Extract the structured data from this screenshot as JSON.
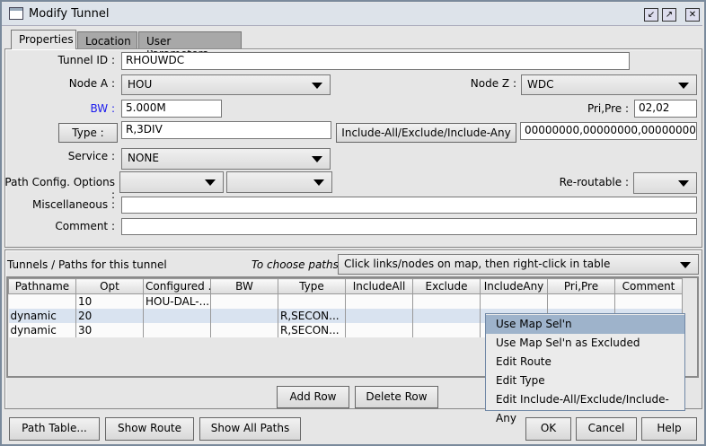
{
  "window": {
    "title": "Modify Tunnel"
  },
  "tabs": [
    {
      "label": "Properties"
    },
    {
      "label": "Location"
    },
    {
      "label": "User Parameters"
    }
  ],
  "form": {
    "tunnel_id_label": "Tunnel ID :",
    "tunnel_id": "RHOUWDC",
    "node_a_label": "Node A :",
    "node_a": "HOU",
    "node_z_label": "Node Z :",
    "node_z": "WDC",
    "bw_label": "BW :",
    "bw": "5.000M",
    "pri_pre_label": "Pri,Pre :",
    "pri_pre": "02,02",
    "type_button": "Type :",
    "type": "R,3DIV",
    "include_button": "Include-All/Exclude/Include-Any",
    "include_value": "00000000,00000000,00000000",
    "service_label": "Service :",
    "service": "NONE",
    "path_config_label": "Path Config. Options :",
    "path_config_1": "",
    "path_config_2": "",
    "reroutable_label": "Re-routable :",
    "reroutable": "",
    "misc_label": "Miscellaneous :",
    "misc": "",
    "comment_label": "Comment :",
    "comment": ""
  },
  "paths": {
    "label": "Tunnels / Paths for this tunnel",
    "choose_label": "To choose paths:",
    "choose_value": "Click links/nodes on map, then right-click in table",
    "columns": [
      "Pathname",
      "Opt",
      "Configured ...",
      "BW",
      "Type",
      "IncludeAll",
      "Exclude",
      "IncludeAny",
      "Pri,Pre",
      "Comment"
    ],
    "rows": [
      [
        "",
        "10",
        "HOU-DAL-...",
        "",
        "",
        "",
        "",
        "",
        "",
        ""
      ],
      [
        "dynamic",
        "20",
        "",
        "",
        "R,SECON...",
        "",
        "",
        "",
        "",
        ""
      ],
      [
        "dynamic",
        "30",
        "",
        "",
        "R,SECON...",
        "",
        "",
        "",
        "",
        ""
      ]
    ],
    "add_row": "Add Row",
    "delete_row": "Delete Row"
  },
  "context_menu": [
    "Use Map Sel'n",
    "Use Map Sel'n as Excluded",
    "Edit Route",
    "Edit Type",
    "Edit Include-All/Exclude/Include-Any"
  ],
  "footer": {
    "path_table": "Path Table...",
    "show_route": "Show Route",
    "show_all_paths": "Show All Paths",
    "ok": "OK",
    "cancel": "Cancel",
    "help": "Help"
  },
  "colors": {
    "bw_label": "#1a1aee",
    "selected_row": "#d9e3f0",
    "menu_highlight": "#9eb3cb"
  }
}
